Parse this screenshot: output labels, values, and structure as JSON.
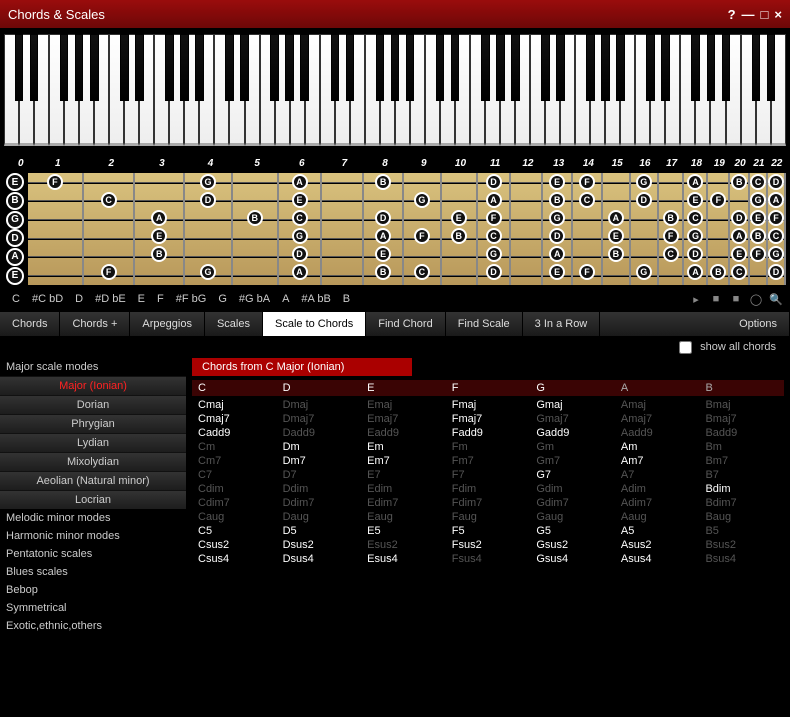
{
  "title": "Chords & Scales",
  "window_controls": {
    "help": "?",
    "min": "—",
    "max": "□",
    "close": "×"
  },
  "root_notes": [
    "C",
    "#C  bD",
    "D",
    "#D  bE",
    "E",
    "F",
    "#F  bG",
    "G",
    "#G  bA",
    "A",
    "#A  bB",
    "B"
  ],
  "main_tabs": [
    "Chords",
    "Chords +",
    "Arpeggios",
    "Scales",
    "Scale to Chords",
    "Find Chord",
    "Find Scale",
    "3 In a Row"
  ],
  "active_main_tab": 4,
  "options_label": "Options",
  "show_all_label": "show all chords",
  "sidebar": {
    "sections": [
      {
        "header": "Major scale modes",
        "items": [
          "Major (Ionian)",
          "Dorian",
          "Phrygian",
          "Lydian",
          "Mixolydian",
          "Aeolian (Natural minor)",
          "Locrian"
        ],
        "active": 0
      },
      {
        "header": "Melodic minor modes",
        "items": []
      },
      {
        "header": "Harmonic minor modes",
        "items": []
      },
      {
        "header": "Pentatonic scales",
        "items": []
      },
      {
        "header": "Blues scales",
        "items": []
      },
      {
        "header": "Bebop",
        "items": []
      },
      {
        "header": "Symmetrical",
        "items": []
      },
      {
        "header": "Exotic,ethnic,others",
        "items": []
      }
    ]
  },
  "panel_title": "Chords from C Major (Ionian)",
  "columns": [
    "C",
    "D",
    "E",
    "F",
    "G",
    "A",
    "B"
  ],
  "rows": [
    [
      {
        "t": "Cmaj",
        "in": true
      },
      {
        "t": "Dmaj",
        "in": false
      },
      {
        "t": "Emaj",
        "in": false
      },
      {
        "t": "Fmaj",
        "in": true
      },
      {
        "t": "Gmaj",
        "in": true
      },
      {
        "t": "Amaj",
        "in": false
      },
      {
        "t": "Bmaj",
        "in": false
      }
    ],
    [
      {
        "t": "Cmaj7",
        "in": true
      },
      {
        "t": "Dmaj7",
        "in": false
      },
      {
        "t": "Emaj7",
        "in": false
      },
      {
        "t": "Fmaj7",
        "in": true
      },
      {
        "t": "Gmaj7",
        "in": false
      },
      {
        "t": "Amaj7",
        "in": false
      },
      {
        "t": "Bmaj7",
        "in": false
      }
    ],
    [
      {
        "t": "Cadd9",
        "in": true
      },
      {
        "t": "Dadd9",
        "in": false
      },
      {
        "t": "Eadd9",
        "in": false
      },
      {
        "t": "Fadd9",
        "in": true
      },
      {
        "t": "Gadd9",
        "in": true
      },
      {
        "t": "Aadd9",
        "in": false
      },
      {
        "t": "Badd9",
        "in": false
      }
    ],
    [
      {
        "t": "Cm",
        "in": false
      },
      {
        "t": "Dm",
        "in": true
      },
      {
        "t": "Em",
        "in": true
      },
      {
        "t": "Fm",
        "in": false
      },
      {
        "t": "Gm",
        "in": false
      },
      {
        "t": "Am",
        "in": true
      },
      {
        "t": "Bm",
        "in": false
      }
    ],
    [
      {
        "t": "Cm7",
        "in": false
      },
      {
        "t": "Dm7",
        "in": true
      },
      {
        "t": "Em7",
        "in": true
      },
      {
        "t": "Fm7",
        "in": false
      },
      {
        "t": "Gm7",
        "in": false
      },
      {
        "t": "Am7",
        "in": true
      },
      {
        "t": "Bm7",
        "in": false
      }
    ],
    [
      {
        "t": "C7",
        "in": false
      },
      {
        "t": "D7",
        "in": false
      },
      {
        "t": "E7",
        "in": false
      },
      {
        "t": "F7",
        "in": false
      },
      {
        "t": "G7",
        "in": true
      },
      {
        "t": "A7",
        "in": false
      },
      {
        "t": "B7",
        "in": false
      }
    ],
    [
      {
        "t": "Cdim",
        "in": false
      },
      {
        "t": "Ddim",
        "in": false
      },
      {
        "t": "Edim",
        "in": false
      },
      {
        "t": "Fdim",
        "in": false
      },
      {
        "t": "Gdim",
        "in": false
      },
      {
        "t": "Adim",
        "in": false
      },
      {
        "t": "Bdim",
        "in": true
      }
    ],
    [
      {
        "t": "Cdim7",
        "in": false
      },
      {
        "t": "Ddim7",
        "in": false
      },
      {
        "t": "Edim7",
        "in": false
      },
      {
        "t": "Fdim7",
        "in": false
      },
      {
        "t": "Gdim7",
        "in": false
      },
      {
        "t": "Adim7",
        "in": false
      },
      {
        "t": "Bdim7",
        "in": false
      }
    ],
    [
      {
        "t": "Caug",
        "in": false
      },
      {
        "t": "Daug",
        "in": false
      },
      {
        "t": "Eaug",
        "in": false
      },
      {
        "t": "Faug",
        "in": false
      },
      {
        "t": "Gaug",
        "in": false
      },
      {
        "t": "Aaug",
        "in": false
      },
      {
        "t": "Baug",
        "in": false
      }
    ],
    [
      {
        "t": "C5",
        "in": true
      },
      {
        "t": "D5",
        "in": true
      },
      {
        "t": "E5",
        "in": true
      },
      {
        "t": "F5",
        "in": true
      },
      {
        "t": "G5",
        "in": true
      },
      {
        "t": "A5",
        "in": true
      },
      {
        "t": "B5",
        "in": false
      }
    ],
    [
      {
        "t": "Csus2",
        "in": true
      },
      {
        "t": "Dsus2",
        "in": true
      },
      {
        "t": "Esus2",
        "in": false
      },
      {
        "t": "Fsus2",
        "in": true
      },
      {
        "t": "Gsus2",
        "in": true
      },
      {
        "t": "Asus2",
        "in": true
      },
      {
        "t": "Bsus2",
        "in": false
      }
    ],
    [
      {
        "t": "Csus4",
        "in": true
      },
      {
        "t": "Dsus4",
        "in": true
      },
      {
        "t": "Esus4",
        "in": true
      },
      {
        "t": "Fsus4",
        "in": false
      },
      {
        "t": "Gsus4",
        "in": true
      },
      {
        "t": "Asus4",
        "in": true
      },
      {
        "t": "Bsus4",
        "in": false
      }
    ]
  ],
  "fret_numbers": [
    "0",
    "1",
    "2",
    "3",
    "4",
    "5",
    "6",
    "7",
    "8",
    "9",
    "10",
    "11",
    "12",
    "13",
    "14",
    "15",
    "16",
    "17",
    "18",
    "19",
    "20",
    "21",
    "22"
  ],
  "open_strings": [
    "E",
    "B",
    "G",
    "D",
    "A",
    "E"
  ],
  "fret_widths": [
    56,
    52,
    50,
    48,
    46,
    44,
    42,
    40,
    38,
    36,
    34,
    32,
    30,
    30,
    28,
    28,
    26,
    24,
    22,
    20,
    18,
    18
  ],
  "fret_notes": {
    "0": [
      [
        "F",
        0
      ]
    ],
    "1": [
      [
        "F",
        5
      ],
      [
        "C",
        1
      ]
    ],
    "2": [
      [
        "A",
        2
      ],
      [
        "E",
        3
      ],
      [
        "B",
        4
      ]
    ],
    "3": [
      [
        "G",
        0
      ],
      [
        "D",
        1
      ],
      [
        "G",
        5
      ]
    ],
    "4": [
      [
        "B",
        2
      ]
    ],
    "5": [
      [
        "A",
        0
      ],
      [
        "E",
        1
      ],
      [
        "C",
        2
      ],
      [
        "G",
        3
      ],
      [
        "D",
        4
      ],
      [
        "A",
        5
      ]
    ],
    "6": [],
    "7": [
      [
        "B",
        0
      ],
      [
        "D",
        2
      ],
      [
        "A",
        3
      ],
      [
        "E",
        4
      ],
      [
        "B",
        5
      ]
    ],
    "8": [
      [
        "G",
        1
      ],
      [
        "F",
        3
      ],
      [
        "C",
        5
      ]
    ],
    "9": [
      [
        "E",
        2
      ],
      [
        "B",
        3
      ]
    ],
    "10": [
      [
        "D",
        0
      ],
      [
        "A",
        1
      ],
      [
        "F",
        2
      ],
      [
        "C",
        3
      ],
      [
        "G",
        4
      ],
      [
        "D",
        5
      ]
    ],
    "11": [],
    "12": [
      [
        "E",
        0
      ],
      [
        "B",
        1
      ],
      [
        "G",
        2
      ],
      [
        "D",
        3
      ],
      [
        "A",
        4
      ],
      [
        "E",
        5
      ]
    ],
    "13": [
      [
        "F",
        0
      ],
      [
        "C",
        1
      ],
      [
        "F",
        5
      ]
    ],
    "14": [
      [
        "A",
        2
      ],
      [
        "E",
        3
      ],
      [
        "B",
        4
      ]
    ],
    "15": [
      [
        "G",
        0
      ],
      [
        "D",
        1
      ],
      [
        "G",
        5
      ]
    ],
    "16": [
      [
        "B",
        2
      ],
      [
        "F",
        3
      ],
      [
        "C",
        4
      ]
    ],
    "17": [
      [
        "A",
        0
      ],
      [
        "E",
        1
      ],
      [
        "C",
        2
      ],
      [
        "G",
        3
      ],
      [
        "D",
        4
      ],
      [
        "A",
        5
      ]
    ],
    "18": [
      [
        "F",
        1
      ],
      [
        "B",
        5
      ]
    ],
    "19": [
      [
        "B",
        0
      ],
      [
        "D",
        2
      ],
      [
        "A",
        3
      ],
      [
        "E",
        4
      ],
      [
        "C",
        5
      ]
    ],
    "20": [
      [
        "C",
        0
      ],
      [
        "G",
        1
      ],
      [
        "E",
        2
      ],
      [
        "B",
        3
      ],
      [
        "F",
        4
      ]
    ],
    "21": [
      [
        "D",
        0
      ],
      [
        "A",
        1
      ],
      [
        "F",
        2
      ],
      [
        "C",
        3
      ],
      [
        "G",
        4
      ],
      [
        "D",
        5
      ]
    ]
  }
}
